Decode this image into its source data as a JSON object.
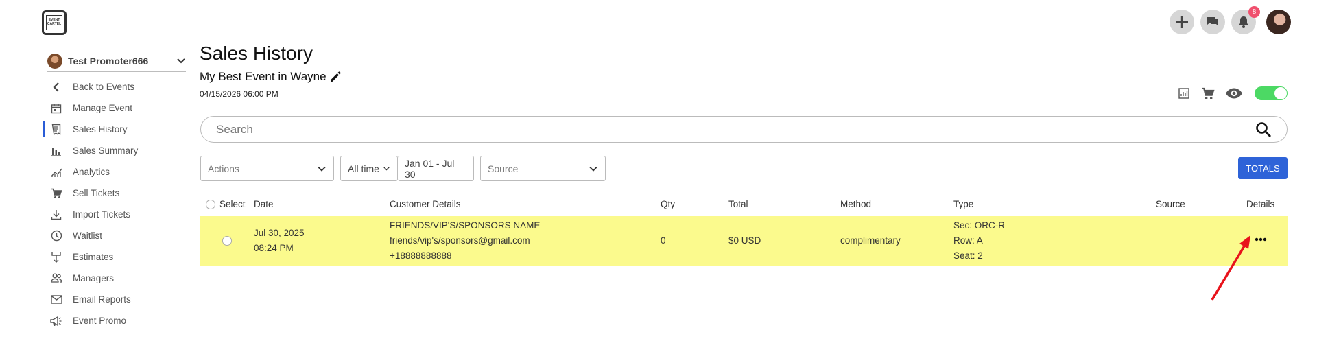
{
  "logo": {
    "text": "EVENT CARTEL"
  },
  "header": {
    "notification_count": "8"
  },
  "sidebar": {
    "promoter_name": "Test Promoter666",
    "items": [
      {
        "label": "Back to Events",
        "icon": "chevron-left-icon"
      },
      {
        "label": "Manage Event",
        "icon": "calendar-icon"
      },
      {
        "label": "Sales History",
        "icon": "receipt-icon",
        "active": true
      },
      {
        "label": "Sales Summary",
        "icon": "bar-chart-icon"
      },
      {
        "label": "Analytics",
        "icon": "analytics-icon"
      },
      {
        "label": "Sell Tickets",
        "icon": "cart-icon"
      },
      {
        "label": "Import Tickets",
        "icon": "download-icon"
      },
      {
        "label": "Waitlist",
        "icon": "clock-icon"
      },
      {
        "label": "Estimates",
        "icon": "fork-icon"
      },
      {
        "label": "Managers",
        "icon": "people-icon"
      },
      {
        "label": "Email Reports",
        "icon": "mail-icon"
      },
      {
        "label": "Event Promo",
        "icon": "megaphone-icon"
      }
    ]
  },
  "main": {
    "title": "Sales History",
    "event_name": "My Best Event in Wayne",
    "event_date": "04/15/2026 06:00 PM",
    "search_placeholder": "Search",
    "filters": {
      "actions_placeholder": "Actions",
      "time_range": "All time",
      "date_range": "Jan 01 - Jul 30",
      "source_placeholder": "Source"
    },
    "totals_label": "TOTALS"
  },
  "table": {
    "headers": {
      "select": "Select",
      "date": "Date",
      "customer": "Customer Details",
      "qty": "Qty",
      "total": "Total",
      "method": "Method",
      "type": "Type",
      "source": "Source",
      "details": "Details"
    },
    "rows": [
      {
        "date": "Jul 30, 2025",
        "time": "08:24 PM",
        "customer_name": "FRIENDS/VIP'S/SPONSORS NAME",
        "customer_email": "friends/vip's/sponsors@gmail.com",
        "customer_phone": "+18888888888",
        "qty": "0",
        "total": "$0 USD",
        "method": "complimentary",
        "sec": "Sec: ORC-R",
        "row": "Row: A",
        "seat": "Seat: 2",
        "source": "",
        "highlight_color": "#fbfa8d"
      }
    ]
  },
  "colors": {
    "accent": "#2e63d8",
    "toggle_on": "#4cd964",
    "badge": "#f0506e",
    "annotation_arrow": "#e8121b"
  }
}
